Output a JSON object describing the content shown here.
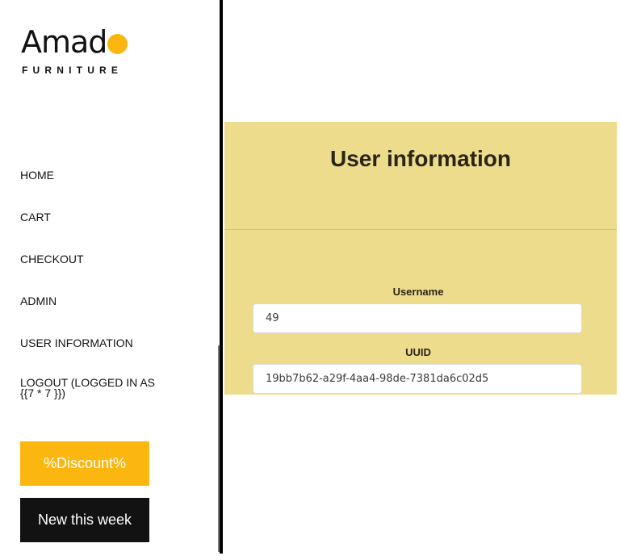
{
  "logo": {
    "word": "Amad",
    "tagline": "FURNITURE"
  },
  "nav": {
    "home": "HOME",
    "cart": "CART",
    "checkout": "CHECKOUT",
    "admin": "ADMIN",
    "user_information": "USER INFORMATION",
    "logout_line1": "LOGOUT (LOGGED IN AS",
    "logout_line2": "{{7 * 7 }})"
  },
  "buttons": {
    "discount": "%Discount%",
    "new_this_week": "New this week"
  },
  "panel": {
    "title": "User information",
    "username_label": "Username",
    "username_value": "49",
    "uuid_label": "UUID",
    "uuid_value": "19bb7b62-a29f-4aa4-98de-7381da6c02d5"
  },
  "colors": {
    "accent": "#fbb710",
    "panel_bg": "#eddc8b",
    "dark": "#131212"
  }
}
